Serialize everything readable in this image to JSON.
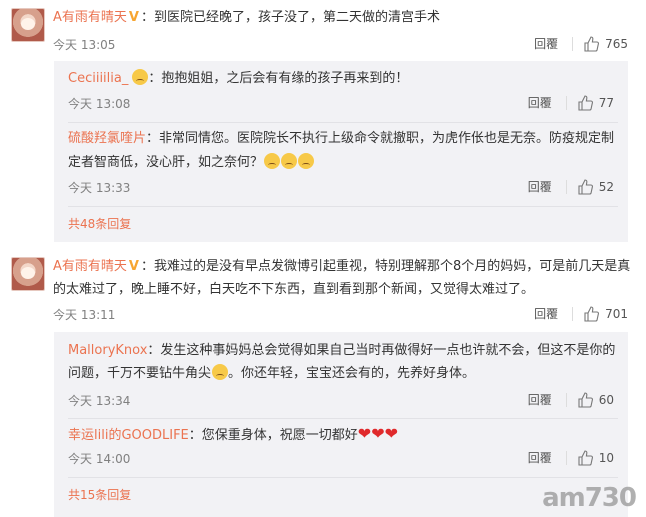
{
  "threads": [
    {
      "user": "A有雨有晴天",
      "text": "：到医院已经晚了，孩子没了，第二天做的清宫手术",
      "time": "今天 13:05",
      "reply": "回覆",
      "likes": "765",
      "subs": [
        {
          "user": "Ceciiiilia_",
          "text": "：抱抱姐姐，之后会有有缘的孩子再来到的！",
          "time": "今天 13:08",
          "reply": "回覆",
          "likes": "77"
        },
        {
          "user": "硫酸羟氯喹片",
          "text": "：非常同情您。医院院长不执行上级命令就撤职，为虎作伥也是无奈。防疫规定制定者智商低，没心肝，如之奈何？",
          "time": "今天 13:33",
          "reply": "回覆",
          "likes": "52"
        }
      ],
      "more": "共48条回复"
    },
    {
      "user": "A有雨有晴天",
      "text": "：我难过的是没有早点发微博引起重视，特别理解那个8个月的妈妈，可是前几天是真的太难过了，晚上睡不好，白天吃不下东西，直到看到那个新闻，又觉得太难过了。",
      "time": "今天 13:11",
      "reply": "回覆",
      "likes": "701",
      "subs": [
        {
          "user": "MalloryKnox",
          "text": "：发生这种事妈妈总会觉得如果自己当时再做得好一点也许就不会，但这不是你的问题，千万不要钻牛角尖",
          "text2": "。你还年轻，宝宝还会有的，先养好身体。",
          "time": "今天 13:34",
          "reply": "回覆",
          "likes": "60"
        },
        {
          "user": "幸运lili的GOODLIFE",
          "text": "：您保重身体，祝愿一切都好",
          "time": "今天 14:00",
          "reply": "回覆",
          "likes": "10"
        }
      ],
      "more": "共15条回复"
    }
  ],
  "watermark": "am730",
  "colors": {
    "username": "#eb7350",
    "badge": "#f7a531",
    "sub_bg": "#f2f2f5"
  }
}
